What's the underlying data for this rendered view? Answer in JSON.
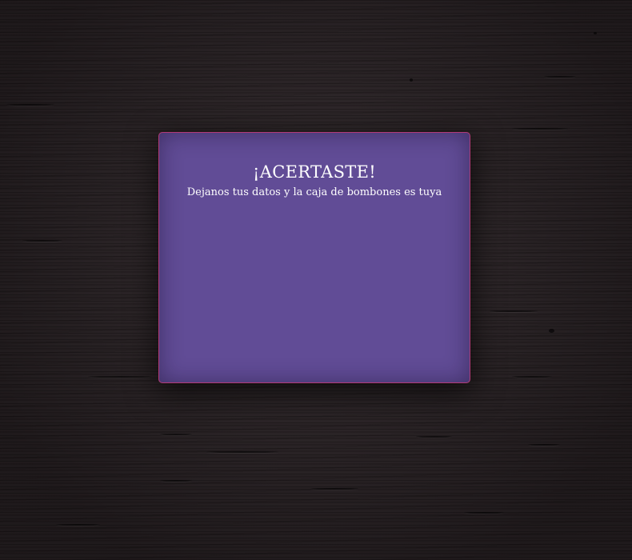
{
  "modal": {
    "title": "¡ACERTASTE!",
    "subtitle": "Dejanos tus datos y la caja de bombones es tuya"
  },
  "colors": {
    "background": "#2c2427",
    "modal_background": "#614c96",
    "modal_border": "#b23a78",
    "text": "#ffffff"
  }
}
